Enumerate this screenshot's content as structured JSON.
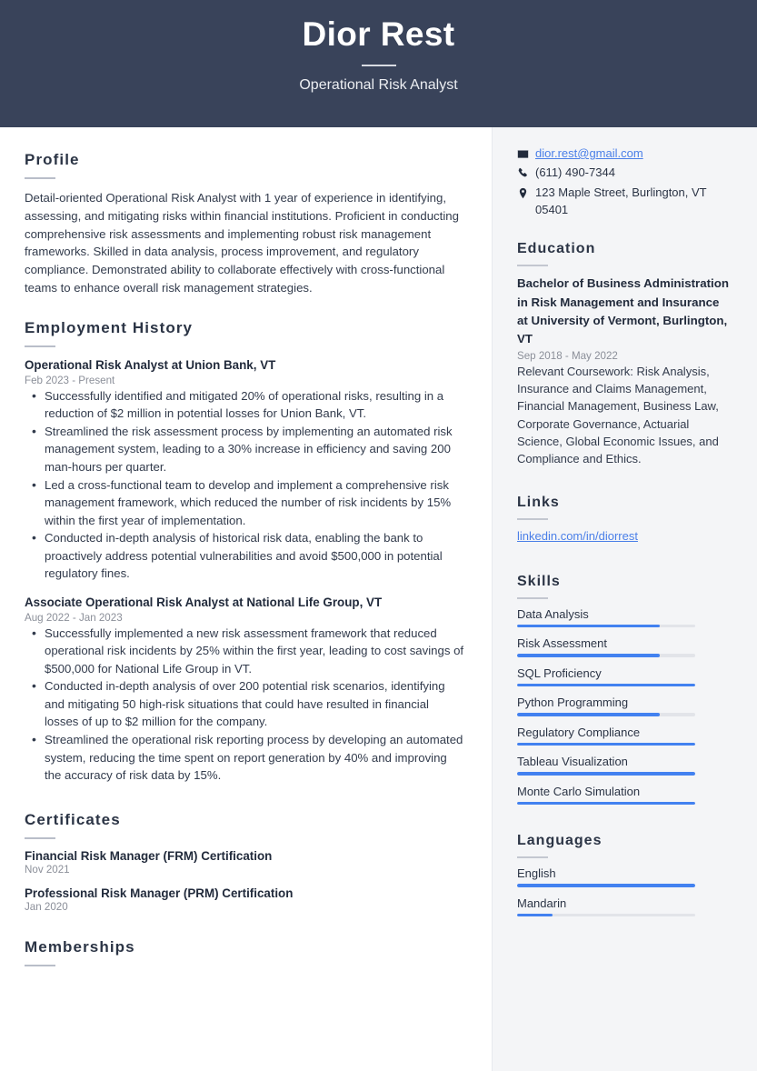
{
  "header": {
    "name": "Dior Rest",
    "job_title": "Operational Risk Analyst",
    "bg_color": "#39435A"
  },
  "main": {
    "profile": {
      "heading": "Profile",
      "text": "Detail-oriented Operational Risk Analyst with 1 year of experience in identifying, assessing, and mitigating risks within financial institutions. Proficient in conducting comprehensive risk assessments and implementing robust risk management frameworks. Skilled in data analysis, process improvement, and regulatory compliance. Demonstrated ability to collaborate effectively with cross-functional teams to enhance overall risk management strategies."
    },
    "employment": {
      "heading": "Employment History",
      "jobs": [
        {
          "title": "Operational Risk Analyst at Union Bank, VT",
          "date": "Feb 2023 - Present",
          "bullets": [
            "Successfully identified and mitigated 20% of operational risks, resulting in a reduction of $2 million in potential losses for Union Bank, VT.",
            "Streamlined the risk assessment process by implementing an automated risk management system, leading to a 30% increase in efficiency and saving 200 man-hours per quarter.",
            "Led a cross-functional team to develop and implement a comprehensive risk management framework, which reduced the number of risk incidents by 15% within the first year of implementation.",
            "Conducted in-depth analysis of historical risk data, enabling the bank to proactively address potential vulnerabilities and avoid $500,000 in potential regulatory fines."
          ]
        },
        {
          "title": "Associate Operational Risk Analyst at National Life Group, VT",
          "date": "Aug 2022 - Jan 2023",
          "bullets": [
            "Successfully implemented a new risk assessment framework that reduced operational risk incidents by 25% within the first year, leading to cost savings of $500,000 for National Life Group in VT.",
            "Conducted in-depth analysis of over 200 potential risk scenarios, identifying and mitigating 50 high-risk situations that could have resulted in financial losses of up to $2 million for the company.",
            "Streamlined the operational risk reporting process by developing an automated system, reducing the time spent on report generation by 40% and improving the accuracy of risk data by 15%."
          ]
        }
      ]
    },
    "certificates": {
      "heading": "Certificates",
      "items": [
        {
          "title": "Financial Risk Manager (FRM) Certification",
          "date": "Nov 2021"
        },
        {
          "title": "Professional Risk Manager (PRM) Certification",
          "date": "Jan 2020"
        }
      ]
    },
    "memberships": {
      "heading": "Memberships"
    }
  },
  "aside": {
    "contact": {
      "email": "dior.rest@gmail.com",
      "phone": "(611) 490-7344",
      "address": "123 Maple Street, Burlington, VT 05401",
      "icons": [
        "envelope-icon",
        "phone-icon",
        "location-pin-icon"
      ]
    },
    "education": {
      "heading": "Education",
      "degree": "Bachelor of Business Administration in Risk Management and Insurance at University of Vermont, Burlington, VT",
      "date": "Sep 2018 - May 2022",
      "description": "Relevant Coursework: Risk Analysis, Insurance and Claims Management, Financial Management, Business Law, Corporate Governance, Actuarial Science, Global Economic Issues, and Compliance and Ethics."
    },
    "links": {
      "heading": "Links",
      "items": [
        {
          "label": "linkedin.com/in/diorrest"
        }
      ]
    },
    "skills": {
      "heading": "Skills",
      "items": [
        {
          "label": "Data Analysis",
          "level": 80
        },
        {
          "label": "Risk Assessment",
          "level": 80
        },
        {
          "label": "SQL Proficiency",
          "level": 100
        },
        {
          "label": "Python Programming",
          "level": 80
        },
        {
          "label": "Regulatory Compliance",
          "level": 100
        },
        {
          "label": "Tableau Visualization",
          "level": 100
        },
        {
          "label": "Monte Carlo Simulation",
          "level": 100
        }
      ]
    },
    "languages": {
      "heading": "Languages",
      "items": [
        {
          "label": "English",
          "level": 100
        },
        {
          "label": "Mandarin",
          "level": 20
        }
      ]
    },
    "accent_color": "#4281F0",
    "link_color": "#4A7FE8",
    "bg_color": "#F4F5F7"
  }
}
